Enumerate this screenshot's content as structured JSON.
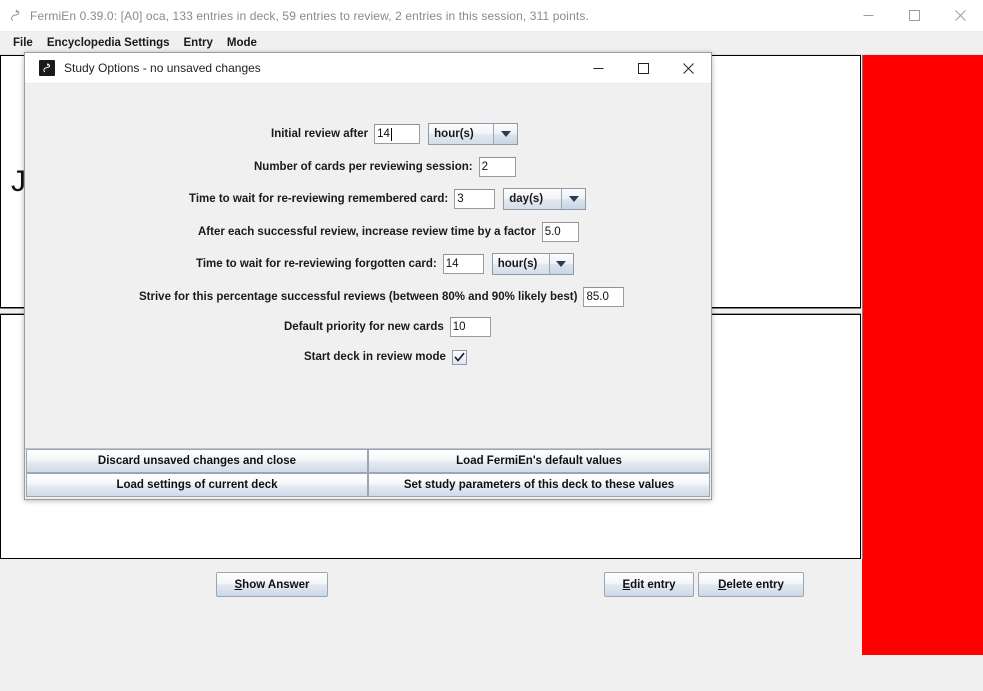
{
  "main_window": {
    "title": "FermiEn 0.39.0: [A0] oca, 133 entries in deck, 59 entries to review, 2 entries in this session, 311 points.",
    "app_icon": "fermien-logo-icon",
    "controls": {
      "minimize": "minimize-icon",
      "maximize": "maximize-icon",
      "close": "close-icon"
    },
    "menu": [
      {
        "label": "File"
      },
      {
        "label": "Encyclopedia Settings"
      },
      {
        "label": "Entry"
      },
      {
        "label": "Mode"
      }
    ],
    "card": {
      "question_text": "J                                                                                                  ch a literal"
    },
    "actions": {
      "show_answer": {
        "mnemonic": "S",
        "rest": "how Answer"
      },
      "edit_entry": {
        "mnemonic": "E",
        "rest": "dit entry"
      },
      "delete_entry": {
        "mnemonic": "D",
        "rest": "elete entry"
      }
    },
    "colors": {
      "accent_panel": "#ff0000",
      "window_bg": "#f0f0f0",
      "card_bg": "#ffffff"
    }
  },
  "dialog": {
    "title": "Study Options - no unsaved changes",
    "icon": "fermien-logo-icon",
    "controls": {
      "minimize": "minimize-icon",
      "maximize": "maximize-icon",
      "close": "close-icon"
    },
    "fields": {
      "initial_review": {
        "label": "Initial review after",
        "value": "14",
        "unit": "hour(s)"
      },
      "cards_per_session": {
        "label": "Number of cards per reviewing session:",
        "value": "2"
      },
      "remembered_wait": {
        "label": "Time to wait for re-reviewing remembered card:",
        "value": "3",
        "unit": "day(s)"
      },
      "success_factor": {
        "label": "After each successful review, increase review time by a factor",
        "value": "5.0"
      },
      "forgotten_wait": {
        "label": "Time to wait for re-reviewing forgotten card:",
        "value": "14",
        "unit": "hour(s)"
      },
      "target_percentage": {
        "label": "Strive for this percentage successful reviews (between 80% and 90% likely best)",
        "value": "85.0"
      },
      "default_priority": {
        "label": "Default priority for new cards",
        "value": "10"
      },
      "start_review_mode": {
        "label": "Start deck in review mode",
        "checked": true
      }
    },
    "buttons": {
      "discard": "Discard unsaved changes and close",
      "load_defaults": "Load FermiEn's default values",
      "load_current_deck": "Load settings of current deck",
      "apply": "Set study parameters of this deck to these values"
    }
  }
}
